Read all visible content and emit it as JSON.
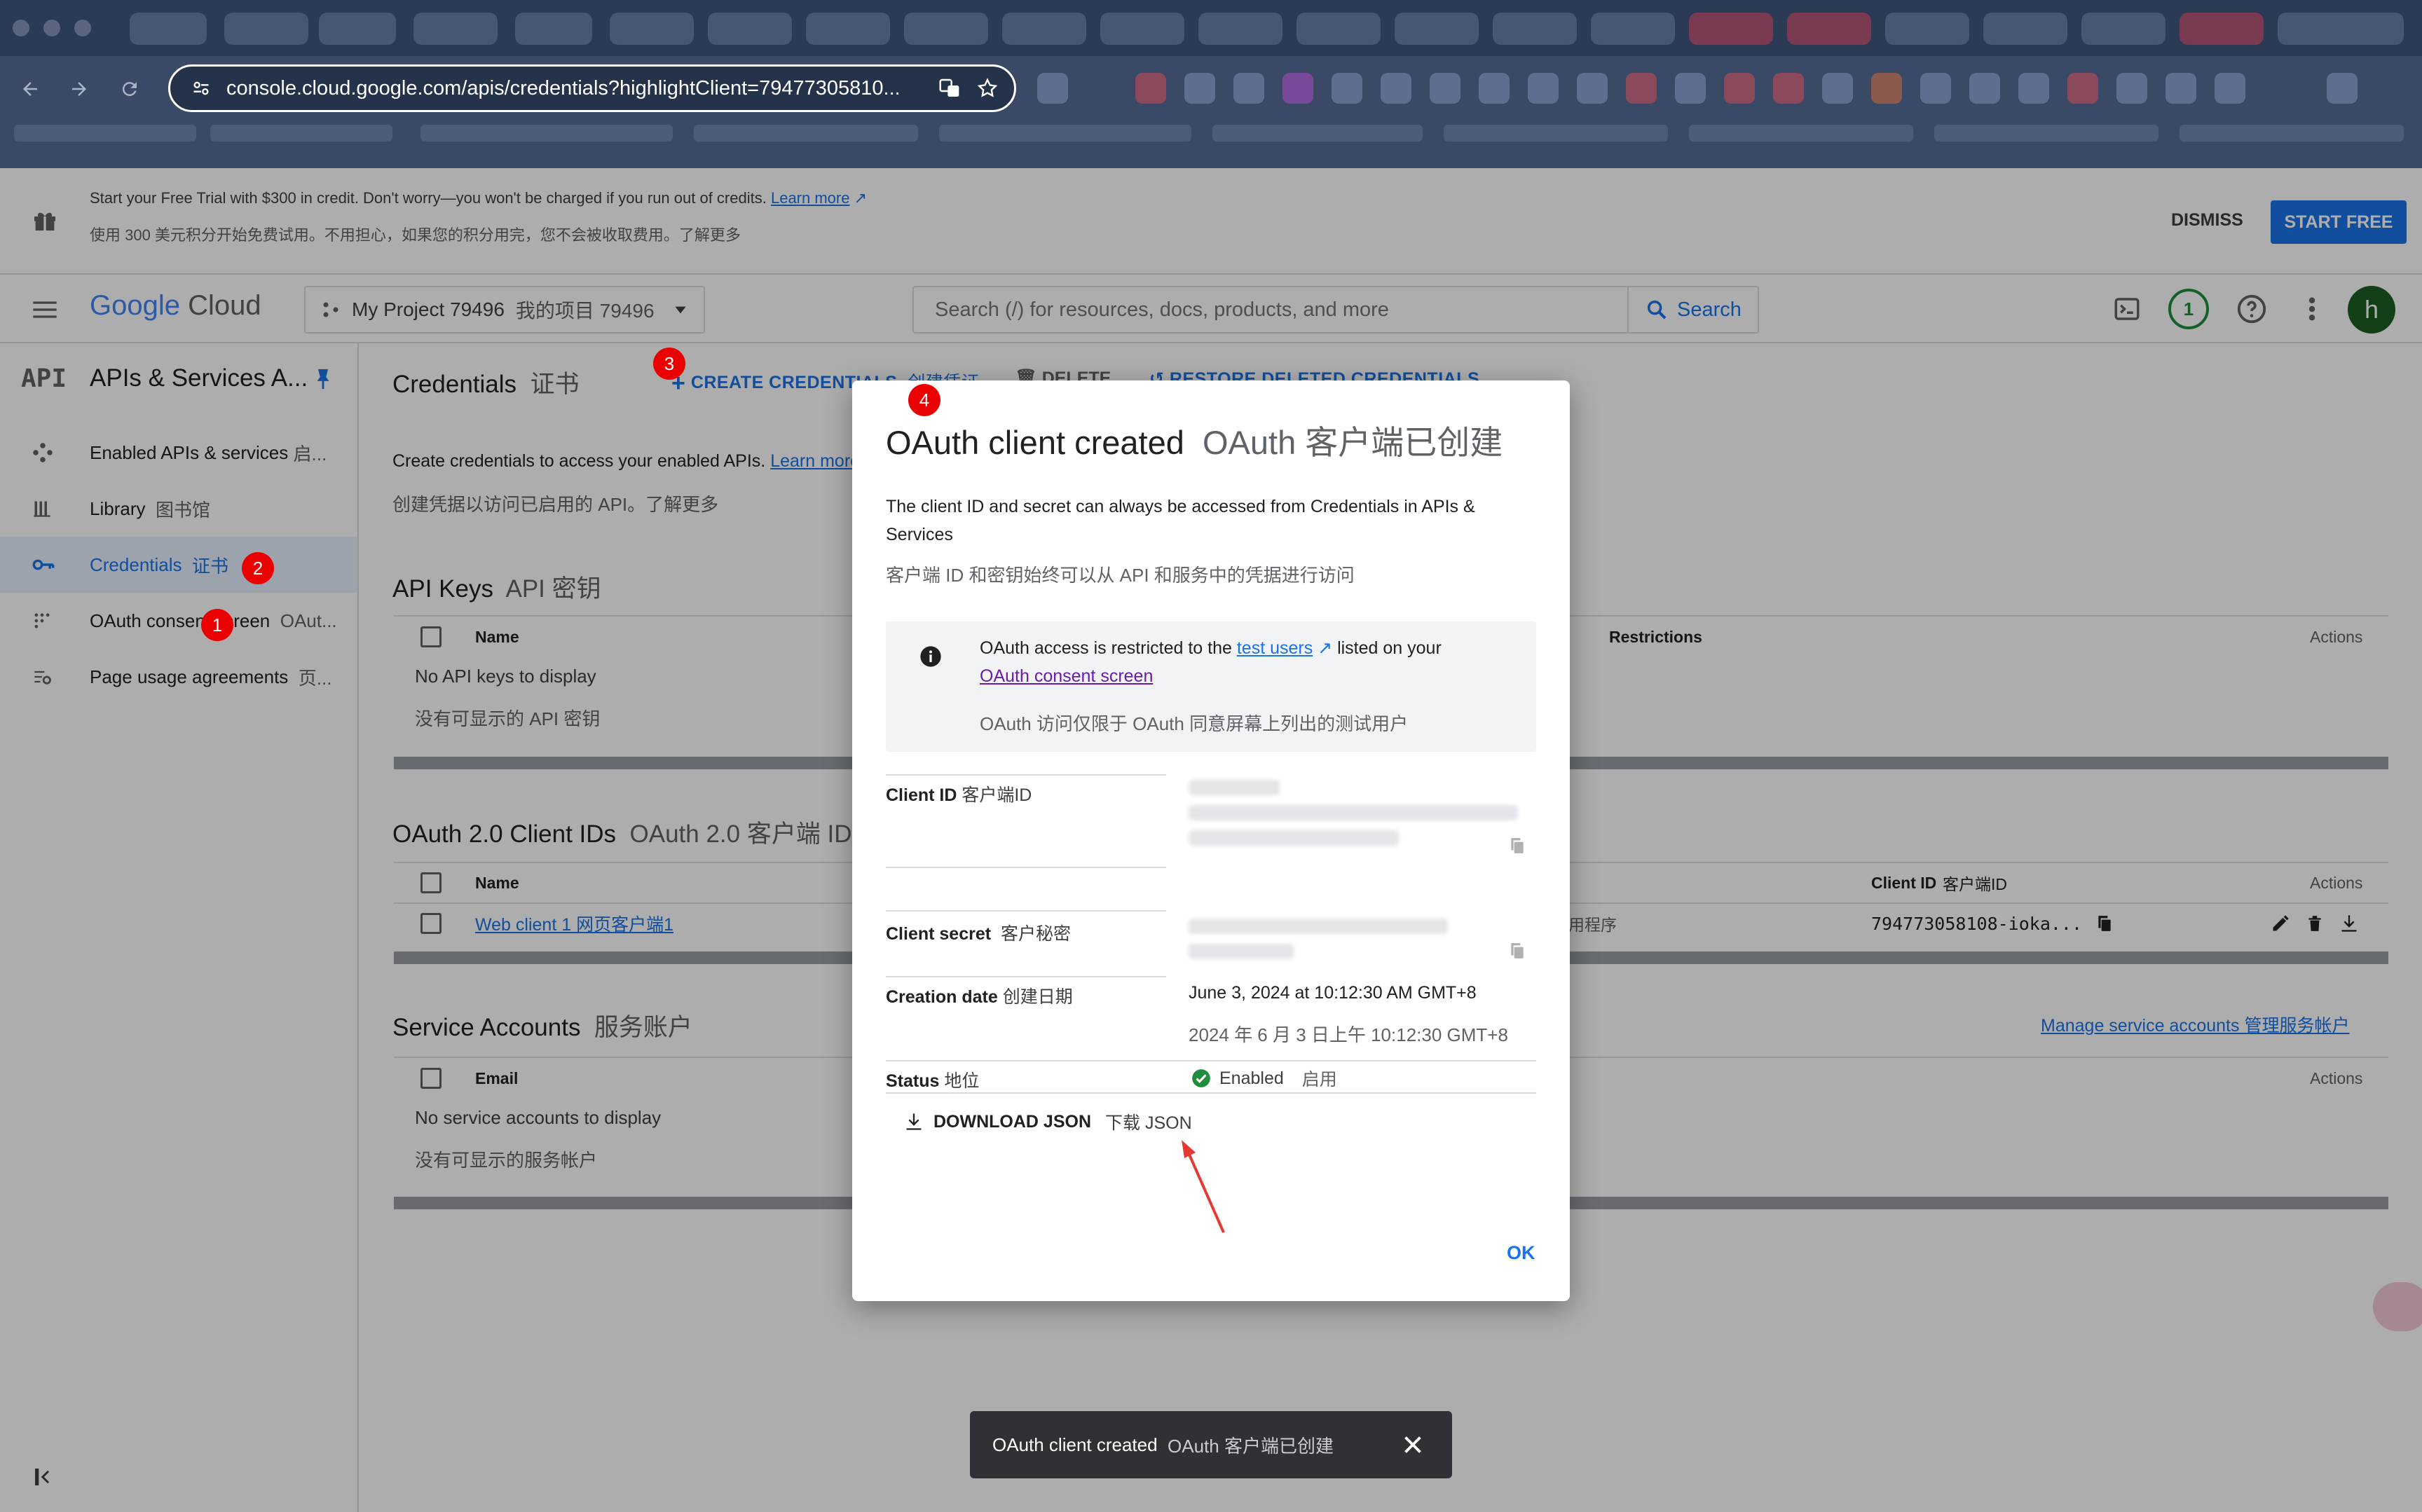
{
  "browser": {
    "url": "console.cloud.google.com/apis/credentials?highlightClient=79477305810..."
  },
  "banner": {
    "line1": "Start your Free Trial with $300 in credit. Don't worry—you won't be charged if you run out of credits.",
    "learn_more": "Learn more",
    "line2": "使用 300 美元积分开始免费试用。不用担心，如果您的积分用完，您不会被收取费用。了解更多",
    "dismiss": "DISMISS",
    "start_free": "START FREE"
  },
  "appbar": {
    "logo_google": "Google",
    "logo_cloud": "Cloud",
    "project": "My Project 79496",
    "project_zh": "我的项目 79496",
    "search_placeholder": "Search (/) for resources, docs, products, and more",
    "search_button": "Search",
    "notifications_count": "1",
    "avatar_letter": "h"
  },
  "sidenav": {
    "api_glyph": "API",
    "title": "APIs & Services A...",
    "items": [
      {
        "label": "Enabled APIs & services",
        "zh": "启..."
      },
      {
        "label": "Library",
        "zh": "图书馆"
      },
      {
        "label": "Credentials",
        "zh": "证书"
      },
      {
        "label": "OAuth consent screen",
        "zh": "OAut..."
      },
      {
        "label": "Page usage agreements",
        "zh": "页..."
      }
    ]
  },
  "header": {
    "title": "Credentials",
    "title_zh": "证书",
    "create": "CREATE CREDENTIALS",
    "create_zh": "创建凭证",
    "delete": "DELETE",
    "restore": "RESTORE DELETED CREDENTIALS"
  },
  "main": {
    "intro": "Create credentials to access your enabled APIs.",
    "intro_link": "Learn more",
    "intro_zh": "创建凭据以访问已启用的 API。了解更多",
    "api_keys": {
      "title": "API Keys",
      "title_zh": "API 密钥",
      "col_name": "Name",
      "col_restrictions": "Restrictions",
      "col_actions": "Actions",
      "empty": "No API keys to display",
      "empty_zh": "没有可显示的 API 密钥"
    },
    "oauth": {
      "title": "OAuth 2.0 Client IDs",
      "title_zh": "OAuth 2.0 客户端 ID",
      "col_name": "Name",
      "col_client_id": "Client ID",
      "col_client_id_zh": "客户端ID",
      "col_actions": "Actions",
      "row_name": "Web client 1",
      "row_name_zh": "网页客户端1",
      "row_type": "用程序",
      "row_client_id": "794773058108-ioka..."
    },
    "service_accounts": {
      "title": "Service Accounts",
      "title_zh": "服务账户",
      "manage": "Manage service accounts",
      "manage_zh": "管理服务帐户",
      "col_email": "Email",
      "col_actions": "Actions",
      "empty": "No service accounts to display",
      "empty_zh": "没有可显示的服务帐户"
    }
  },
  "dialog": {
    "title": "OAuth client created",
    "title_zh": "OAuth 客户端已创建",
    "desc": "The client ID and secret can always be accessed from Credentials in APIs & Services",
    "desc_zh": "客户端 ID 和密钥始终可以从 API 和服务中的凭据进行访问",
    "info_pre": "OAuth access is restricted to the",
    "info_link1": "test users",
    "info_mid": "listed on your",
    "info_link2": "OAuth consent screen",
    "info_zh": "OAuth 访问仅限于 OAuth 同意屏幕上列出的测试用户",
    "client_id_label": "Client ID",
    "client_id_label_zh": "客户端ID",
    "client_secret_label": "Client secret",
    "client_secret_label_zh": "客户秘密",
    "creation_label": "Creation date",
    "creation_label_zh": "创建日期",
    "creation_value": "June 3, 2024 at 10:12:30 AM GMT+8",
    "creation_value_zh": "2024 年 6 月 3 日上午 10:12:30 GMT+8",
    "status_label": "Status",
    "status_label_zh": "地位",
    "status_value": "Enabled",
    "status_value_zh": "启用",
    "download": "DOWNLOAD JSON",
    "download_zh": "下载 JSON",
    "ok": "OK"
  },
  "snackbar": {
    "text": "OAuth client created",
    "text_zh": "OAuth 客户端已创建"
  },
  "badges": [
    "1",
    "2",
    "3",
    "4"
  ],
  "colors": {
    "accent": "#1a73e8",
    "badge": "#ea0000",
    "success": "#1e8e3e",
    "annotation_arrow": "#e53935"
  }
}
